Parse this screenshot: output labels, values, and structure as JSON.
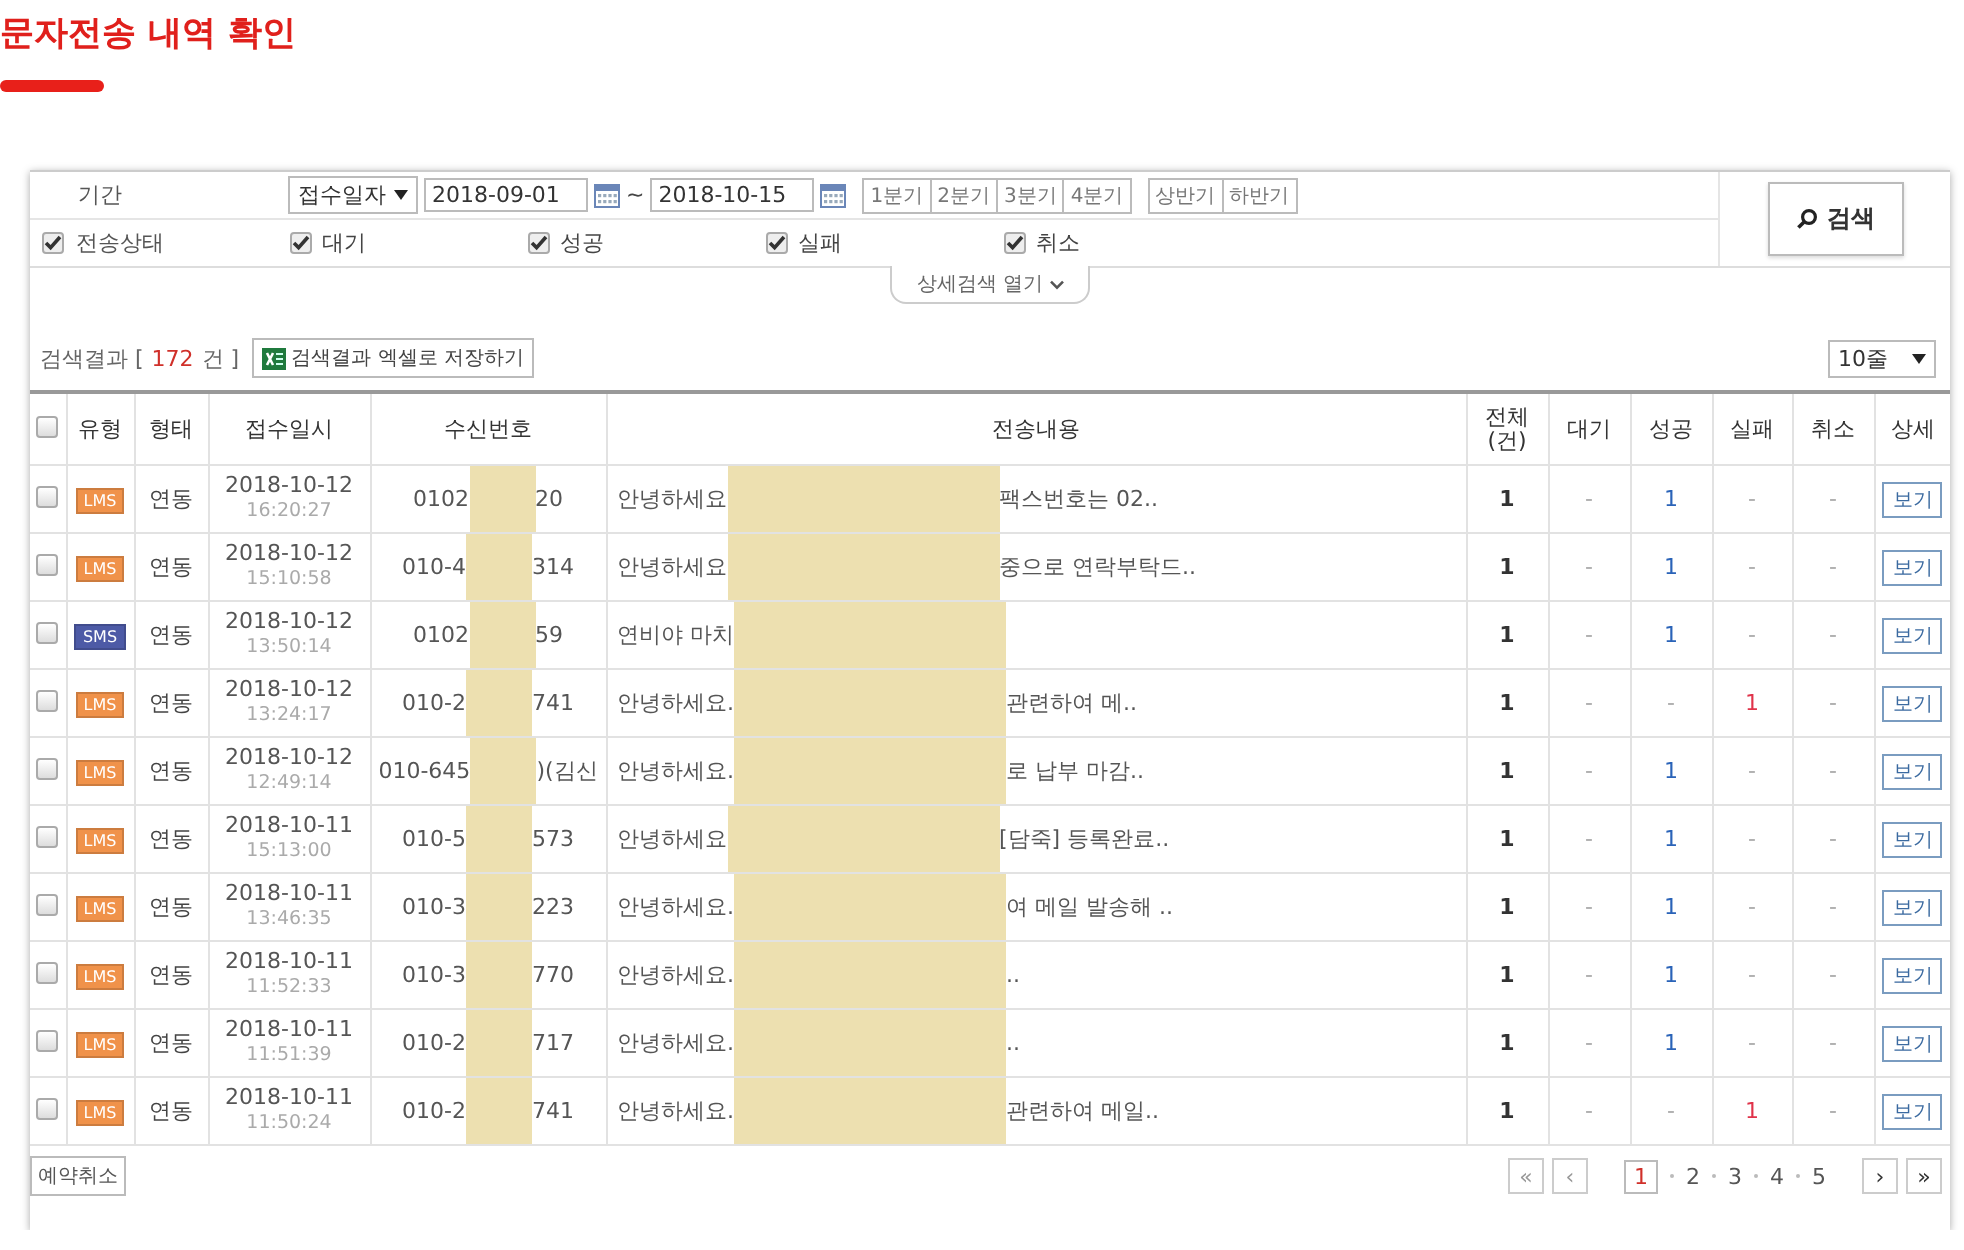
{
  "page_title": "문자전송 내역 확인",
  "filter": {
    "period_label": "기간",
    "date_type": "접수일자",
    "date_from": "2018-09-01",
    "range_sep": "~",
    "date_to": "2018-10-15",
    "quarter_buttons": [
      "1분기",
      "2분기",
      "3분기",
      "4분기"
    ],
    "half_buttons": [
      "상반기",
      "하반기"
    ],
    "status_label": "전송상태",
    "status_all_checked": true,
    "statuses": [
      {
        "label": "대기",
        "checked": true
      },
      {
        "label": "성공",
        "checked": true
      },
      {
        "label": "실패",
        "checked": true
      },
      {
        "label": "취소",
        "checked": true
      }
    ],
    "search_button": "검색",
    "detail_toggle": "상세검색 열기"
  },
  "result": {
    "label": "검색결과 [",
    "count": "172",
    "suffix": "건 ]",
    "excel_button": "검색결과 엑셀로 저장하기",
    "page_size": "10줄"
  },
  "table": {
    "columns": [
      "유형",
      "형태",
      "접수일시",
      "수신번호",
      "전송내용",
      "전체\n(건)",
      "대기",
      "성공",
      "실패",
      "취소",
      "상세"
    ],
    "all_checked": false,
    "rows": [
      {
        "checked": false,
        "type": "LMS",
        "form": "연동",
        "date": "2018-10-12",
        "time": "16:20:27",
        "phone_prefix": "0102",
        "phone_suffix": "20",
        "content_prefix": "안녕하세요",
        "content_suffix": "팩스번호는 02..",
        "total": "1",
        "waiting": "-",
        "success": "1",
        "fail": "-",
        "cancel": "-",
        "detail": "보기"
      },
      {
        "checked": false,
        "type": "LMS",
        "form": "연동",
        "date": "2018-10-12",
        "time": "15:10:58",
        "phone_prefix": "010-4",
        "phone_suffix": "314",
        "content_prefix": "안녕하세요",
        "content_suffix": "중으로 연락부탁드..",
        "total": "1",
        "waiting": "-",
        "success": "1",
        "fail": "-",
        "cancel": "-",
        "detail": "보기"
      },
      {
        "checked": false,
        "type": "SMS",
        "form": "연동",
        "date": "2018-10-12",
        "time": "13:50:14",
        "phone_prefix": "0102",
        "phone_suffix": "59",
        "content_prefix": "연비야 마치",
        "total": "1",
        "waiting": "-",
        "success": "1",
        "fail": "-",
        "cancel": "-",
        "detail": "보기"
      },
      {
        "checked": false,
        "type": "LMS",
        "form": "연동",
        "date": "2018-10-12",
        "time": "13:24:17",
        "phone_prefix": "010-2",
        "phone_suffix": "741",
        "content_prefix": "안녕하세요.",
        "content_suffix": "관련하여 메..",
        "total": "1",
        "waiting": "-",
        "success": "-",
        "fail": "1",
        "cancel": "-",
        "detail": "보기"
      },
      {
        "checked": false,
        "type": "LMS",
        "form": "연동",
        "date": "2018-10-12",
        "time": "12:49:14",
        "phone_prefix": "010-645",
        "phone_suffix": ")(김신",
        "content_prefix": "안녕하세요.",
        "content_suffix": "로 납부 마감..",
        "total": "1",
        "waiting": "-",
        "success": "1",
        "fail": "-",
        "cancel": "-",
        "detail": "보기"
      },
      {
        "checked": false,
        "type": "LMS",
        "form": "연동",
        "date": "2018-10-11",
        "time": "15:13:00",
        "phone_prefix": "010-5",
        "phone_suffix": "573",
        "content_prefix": "안녕하세요",
        "content_suffix": "[담죽] 등록완료..",
        "total": "1",
        "waiting": "-",
        "success": "1",
        "fail": "-",
        "cancel": "-",
        "detail": "보기"
      },
      {
        "checked": false,
        "type": "LMS",
        "form": "연동",
        "date": "2018-10-11",
        "time": "13:46:35",
        "phone_prefix": "010-3",
        "phone_suffix": "223",
        "content_prefix": "안녕하세요.",
        "content_suffix": "여 메일 발송해 ..",
        "total": "1",
        "waiting": "-",
        "success": "1",
        "fail": "-",
        "cancel": "-",
        "detail": "보기"
      },
      {
        "checked": false,
        "type": "LMS",
        "form": "연동",
        "date": "2018-10-11",
        "time": "11:52:33",
        "phone_prefix": "010-3",
        "phone_suffix": "770",
        "content_prefix": "안녕하세요.",
        "content_suffix": "..",
        "total": "1",
        "waiting": "-",
        "success": "1",
        "fail": "-",
        "cancel": "-",
        "detail": "보기"
      },
      {
        "checked": false,
        "type": "LMS",
        "form": "연동",
        "date": "2018-10-11",
        "time": "11:51:39",
        "phone_prefix": "010-2",
        "phone_suffix": "717",
        "content_prefix": "안녕하세요.",
        "content_suffix": "..",
        "total": "1",
        "waiting": "-",
        "success": "1",
        "fail": "-",
        "cancel": "-",
        "detail": "보기"
      },
      {
        "checked": false,
        "type": "LMS",
        "form": "연동",
        "date": "2018-10-11",
        "time": "11:50:24",
        "phone_prefix": "010-2",
        "phone_suffix": "741",
        "content_prefix": "안녕하세요.",
        "content_suffix": "관련하여 메일..",
        "total": "1",
        "waiting": "-",
        "success": "-",
        "fail": "1",
        "cancel": "-",
        "detail": "보기"
      }
    ]
  },
  "footer": {
    "cancel_reservation": "예약취소"
  },
  "pager": {
    "first": "«",
    "prev": "‹",
    "pages": [
      {
        "label": "1",
        "selected": true
      },
      {
        "label": "2",
        "selected": false
      },
      {
        "label": "3",
        "selected": false
      },
      {
        "label": "4",
        "selected": false
      },
      {
        "label": "5",
        "selected": false
      }
    ],
    "next": "›",
    "last": "»"
  }
}
